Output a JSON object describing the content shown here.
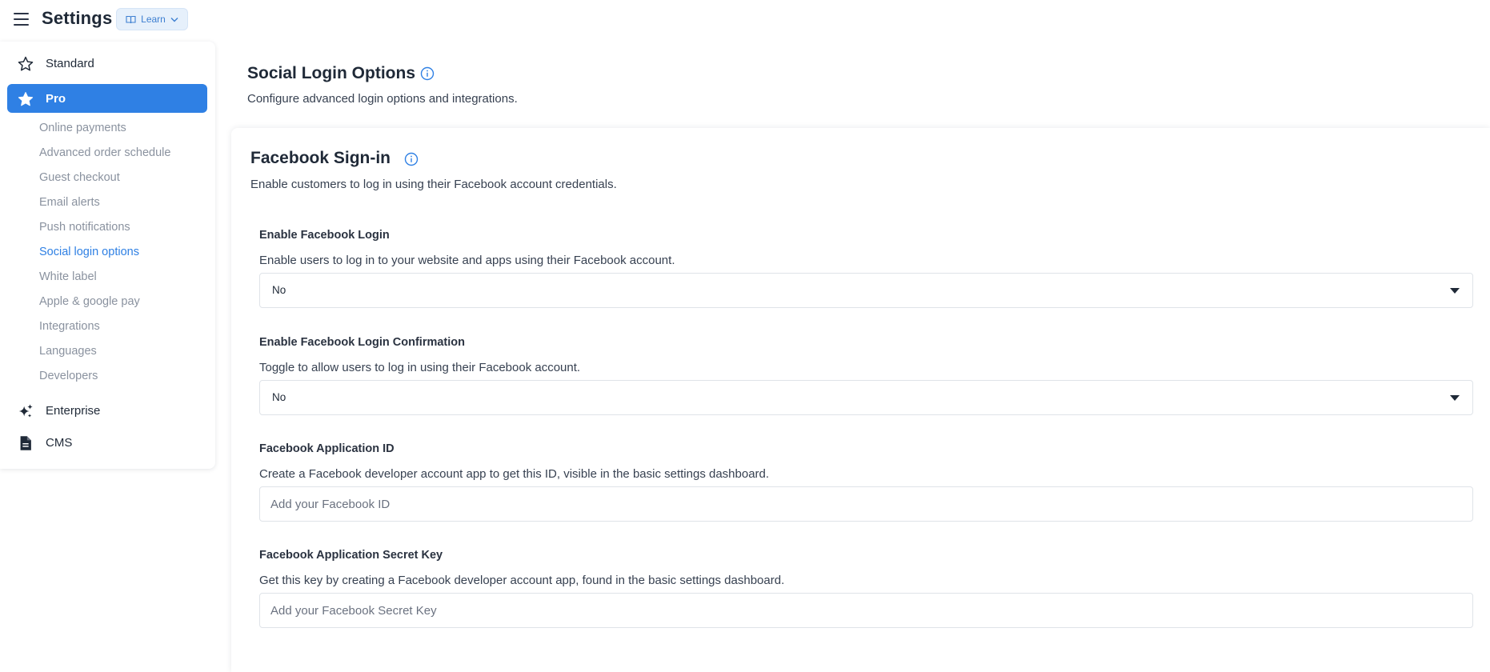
{
  "app": {
    "title": "Settings",
    "learn_label": "Learn"
  },
  "sidebar": {
    "sections": [
      {
        "label": "Standard",
        "icon": "star-outline-icon"
      },
      {
        "label": "Pro",
        "icon": "star-filled-icon"
      },
      {
        "label": "Enterprise",
        "icon": "sparkles-icon"
      },
      {
        "label": "CMS",
        "icon": "document-icon"
      }
    ],
    "pro_items": [
      {
        "label": "Online payments"
      },
      {
        "label": "Advanced order schedule"
      },
      {
        "label": "Guest checkout"
      },
      {
        "label": "Email alerts"
      },
      {
        "label": "Push notifications"
      },
      {
        "label": "Social login options"
      },
      {
        "label": "White label"
      },
      {
        "label": "Apple & google pay"
      },
      {
        "label": "Integrations"
      },
      {
        "label": "Languages"
      },
      {
        "label": "Developers"
      }
    ]
  },
  "page": {
    "title": "Social Login Options",
    "description": "Configure advanced login options and integrations."
  },
  "card": {
    "title": "Facebook Sign-in",
    "description": "Enable customers to log in using their Facebook account credentials.",
    "fields": [
      {
        "label": "Enable Facebook Login",
        "help": "Enable users to log in to your website and apps using their Facebook account.",
        "value": "No"
      },
      {
        "label": "Enable Facebook Login Confirmation",
        "help": "Toggle to allow users to log in using their Facebook account.",
        "value": "No"
      },
      {
        "label": "Facebook Application ID",
        "help": "Create a Facebook developer account app to get this ID, visible in the basic settings dashboard.",
        "placeholder": "Add your Facebook ID"
      },
      {
        "label": "Facebook Application Secret Key",
        "help": "Get this key by creating a Facebook developer account app, found in the basic settings dashboard.",
        "placeholder": "Add your Facebook Secret Key"
      }
    ]
  },
  "colors": {
    "accent": "#2f80e4",
    "learn_bg": "#e6f0fb",
    "muted_text": "#8a929f"
  }
}
